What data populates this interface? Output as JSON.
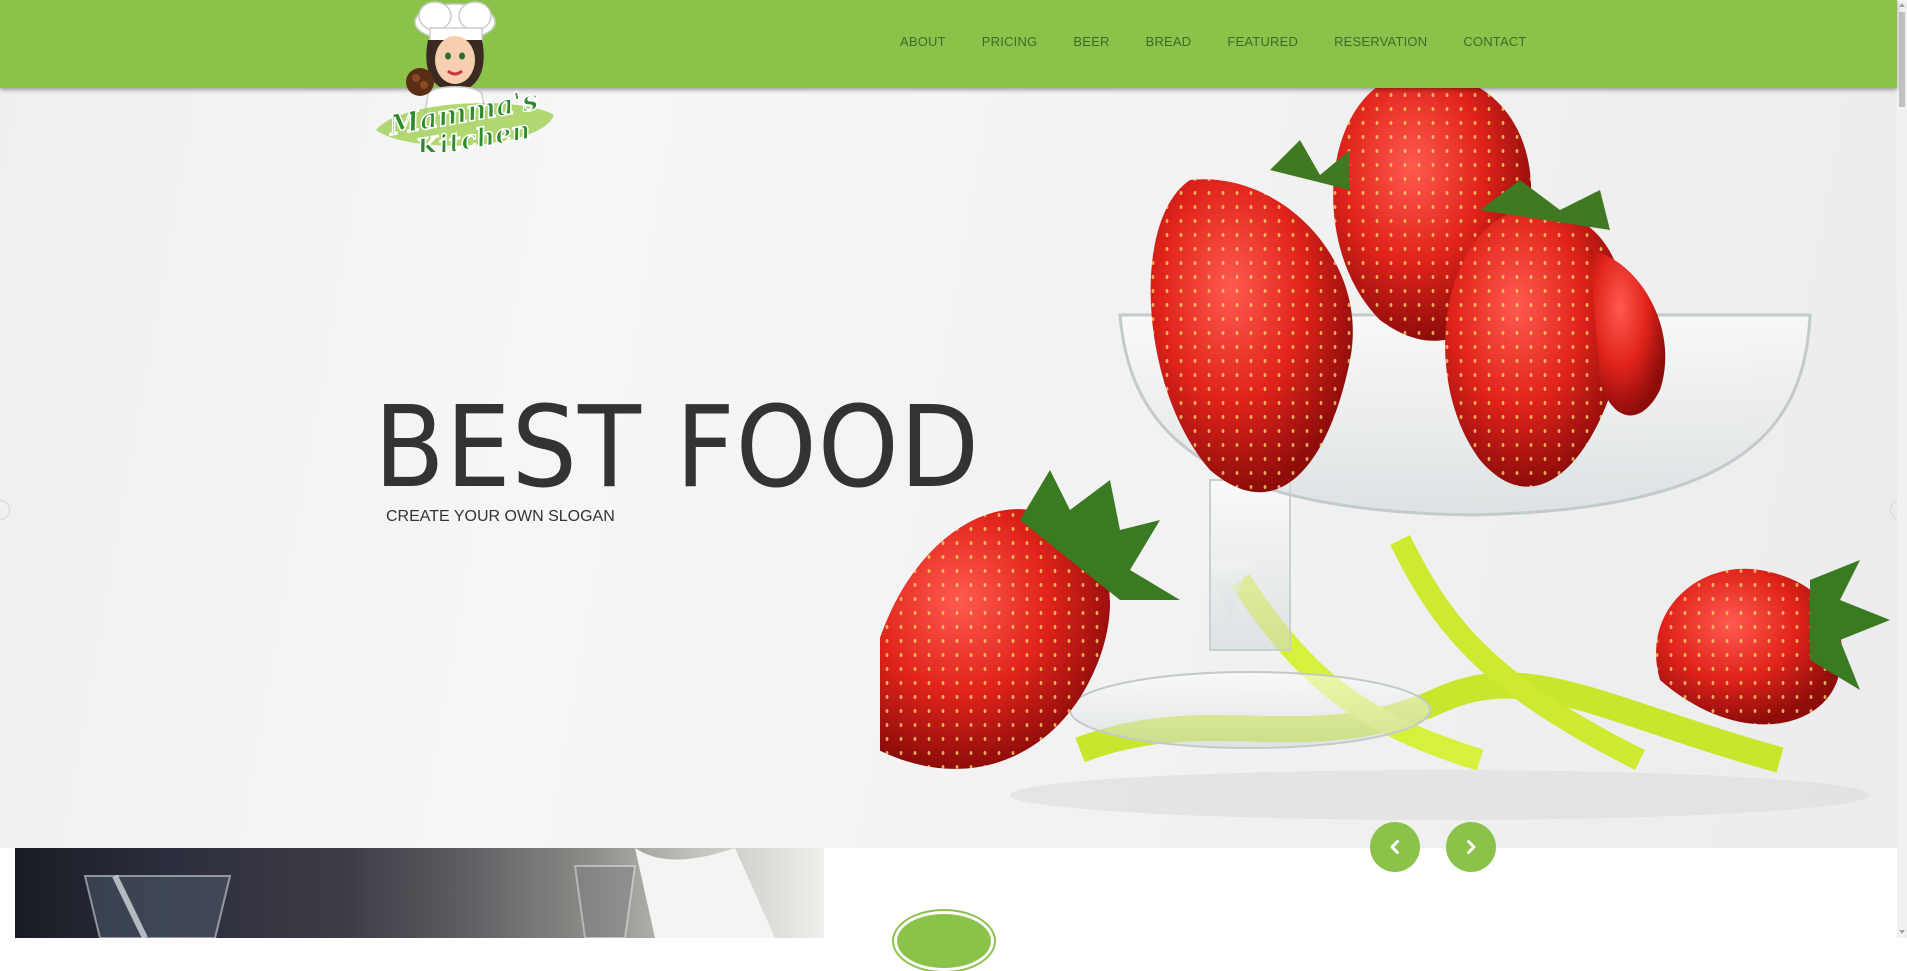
{
  "brand": {
    "logo_name": "Mamma's Kitchen",
    "accent": "#8bc34a",
    "dark_text": "#333333"
  },
  "nav": {
    "items": [
      {
        "label": "ABOUT"
      },
      {
        "label": "PRICING"
      },
      {
        "label": "BEER"
      },
      {
        "label": "BREAD"
      },
      {
        "label": "FEATURED"
      },
      {
        "label": "RESERVATION"
      },
      {
        "label": "CONTACT"
      }
    ]
  },
  "hero": {
    "title": "BEST FOOD",
    "slogan": "CREATE YOUR OWN SLOGAN",
    "image": "strawberries-in-glass-bowl"
  },
  "slider": {
    "prev_icon": "chevron-left-icon",
    "next_icon": "chevron-right-icon"
  }
}
